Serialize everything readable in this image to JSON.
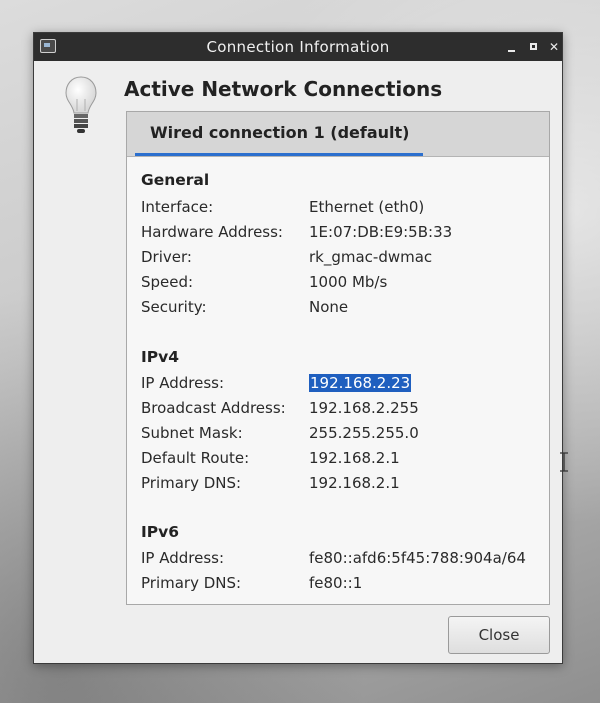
{
  "window": {
    "title": "Connection Information"
  },
  "heading": "Active Network Connections",
  "tabs": [
    {
      "label": "Wired connection 1 (default)",
      "selected": true
    }
  ],
  "sections": {
    "general": {
      "title": "General",
      "rows": [
        {
          "label": "Interface:",
          "value": "Ethernet (eth0)"
        },
        {
          "label": "Hardware Address:",
          "value": "1E:07:DB:E9:5B:33"
        },
        {
          "label": "Driver:",
          "value": "rk_gmac-dwmac"
        },
        {
          "label": "Speed:",
          "value": "1000 Mb/s"
        },
        {
          "label": "Security:",
          "value": "None"
        }
      ]
    },
    "ipv4": {
      "title": "IPv4",
      "rows": [
        {
          "label": "IP Address:",
          "value": "192.168.2.23",
          "selected": true
        },
        {
          "label": "Broadcast Address:",
          "value": "192.168.2.255"
        },
        {
          "label": "Subnet Mask:",
          "value": "255.255.255.0"
        },
        {
          "label": "Default Route:",
          "value": "192.168.2.1"
        },
        {
          "label": "Primary DNS:",
          "value": "192.168.2.1"
        }
      ]
    },
    "ipv6": {
      "title": "IPv6",
      "rows": [
        {
          "label": "IP Address:",
          "value": "fe80::afd6:5f45:788:904a/64"
        },
        {
          "label": "Primary DNS:",
          "value": "fe80::1"
        }
      ]
    }
  },
  "buttons": {
    "close": "Close"
  },
  "colors": {
    "titlebar": "#2d2d2d",
    "tab_accent": "#2b6fce",
    "selection": "#1f5fbf"
  },
  "icons": [
    "app-icon",
    "minimize-icon",
    "maximize-icon",
    "close-icon",
    "lightbulb-icon",
    "text-cursor-icon"
  ]
}
